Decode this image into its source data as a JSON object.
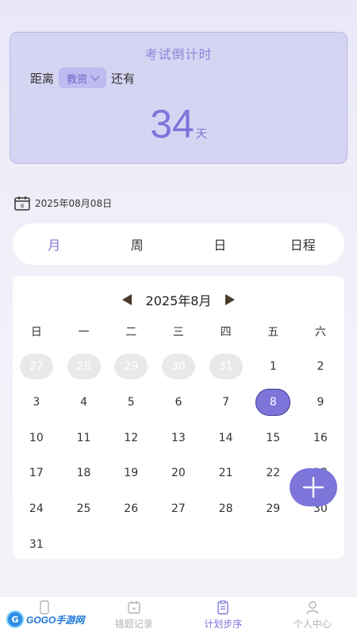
{
  "countdown": {
    "title": "考试倒计时",
    "prefix": "距离",
    "subject": "教资",
    "suffix": "还有",
    "days": "34",
    "unit": "天"
  },
  "current_date": "2025年08月08日",
  "view_tabs": [
    "月",
    "周",
    "日",
    "日程"
  ],
  "active_view": "月",
  "calendar": {
    "month_label": "2025年8月",
    "weekdays": [
      "日",
      "一",
      "二",
      "三",
      "四",
      "五",
      "六"
    ],
    "weeks": [
      [
        "27",
        "28",
        "29",
        "30",
        "31",
        "1",
        "2"
      ],
      [
        "3",
        "4",
        "5",
        "6",
        "7",
        "8",
        "9"
      ],
      [
        "10",
        "11",
        "12",
        "13",
        "14",
        "15",
        "16"
      ],
      [
        "17",
        "18",
        "19",
        "20",
        "21",
        "22",
        "23"
      ],
      [
        "24",
        "25",
        "26",
        "27",
        "28",
        "29",
        "30"
      ],
      [
        "31",
        "",
        "",
        "",
        "",
        "",
        ""
      ]
    ],
    "selected_day": "8"
  },
  "bottom_nav": [
    {
      "label": "",
      "icon": "phone-icon"
    },
    {
      "label": "错题记录",
      "icon": "calendar-icon"
    },
    {
      "label": "计划步序",
      "icon": "clipboard-icon"
    },
    {
      "label": "个人中心",
      "icon": "person-icon"
    }
  ],
  "watermark": {
    "text": "GOGO手游网"
  },
  "colors": {
    "accent": "#7d75da",
    "card": "#d6d4f3"
  }
}
